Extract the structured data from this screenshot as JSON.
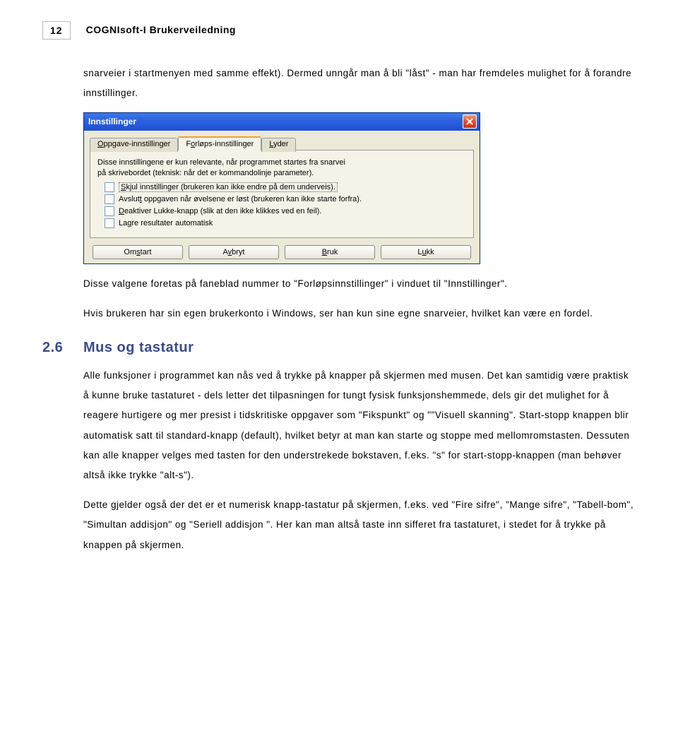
{
  "header": {
    "page_number": "12",
    "doc_title": "COGNIsoft-I Brukerveiledning"
  },
  "intro_para": "snarveier i startmenyen med samme effekt). Dermed unngår man å bli \"låst\" - man har fremdeles mulighet for å forandre innstillinger.",
  "dialog": {
    "title": "Innstillinger",
    "tabs": {
      "t1": "Oppgave-innstillinger",
      "t2": "Forløps-innstillinger",
      "t3": "Lyder"
    },
    "desc_l1": "Disse innstillingene er kun relevante, når programmet startes fra snarvei",
    "desc_l2": "på skrivebordet (teknisk: når det er kommandolinje parameter).",
    "checks": {
      "c1": "Skjul innstillinger (brukeren kan ikke endre på dem underveis).",
      "c2": "Avslutt oppgaven når øvelsene er løst (brukeren kan ikke starte forfra).",
      "c3": "Deaktiver Lukke-knapp (slik at den ikke klikkes ved en feil).",
      "c4": "Lagre resultater automatisk"
    },
    "buttons": {
      "b1": "Omstart",
      "b2": "Avbryt",
      "b3": "Bruk",
      "b4": "Lukk"
    }
  },
  "after_dialog_p1": "Disse valgene foretas på faneblad nummer to \"Forløpsinnstillinger\" i vinduet til \"Innstillinger\".",
  "after_dialog_p2": "Hvis brukeren har sin egen brukerkonto i Windows, ser han kun sine egne snarveier, hvilket kan være en fordel.",
  "section": {
    "num": "2.6",
    "title": "Mus og tastatur"
  },
  "sec_p1": "Alle funksjoner i programmet kan nås ved å trykke på knapper på skjermen med musen. Det kan samtidig være praktisk å kunne bruke tastaturet - dels letter det tilpasningen for tungt fysisk funksjonshemmede, dels gir det mulighet for å reagere hurtigere og mer presist i tidskritiske oppgaver som \"Fikspunkt\" og \"\"Visuell skanning\". Start-stopp knappen blir automatisk satt til standard-knapp (default), hvilket betyr at man kan starte og stoppe med mellomromstasten. Dessuten kan alle knapper velges med tasten for den understrekede bokstaven, f.eks. \"s\" for start-stopp-knappen (man behøver altså ikke trykke \"alt-s\").",
  "sec_p2": "Dette gjelder også der det er et numerisk knapp-tastatur på skjermen, f.eks. ved \"Fire sifre\", \"Mange sifre\", \"Tabell-bom\", \"Simultan addisjon\" og \"Seriell addisjon \". Her kan man altså taste inn sifferet fra tastaturet, i stedet for å trykke på knappen på skjermen."
}
